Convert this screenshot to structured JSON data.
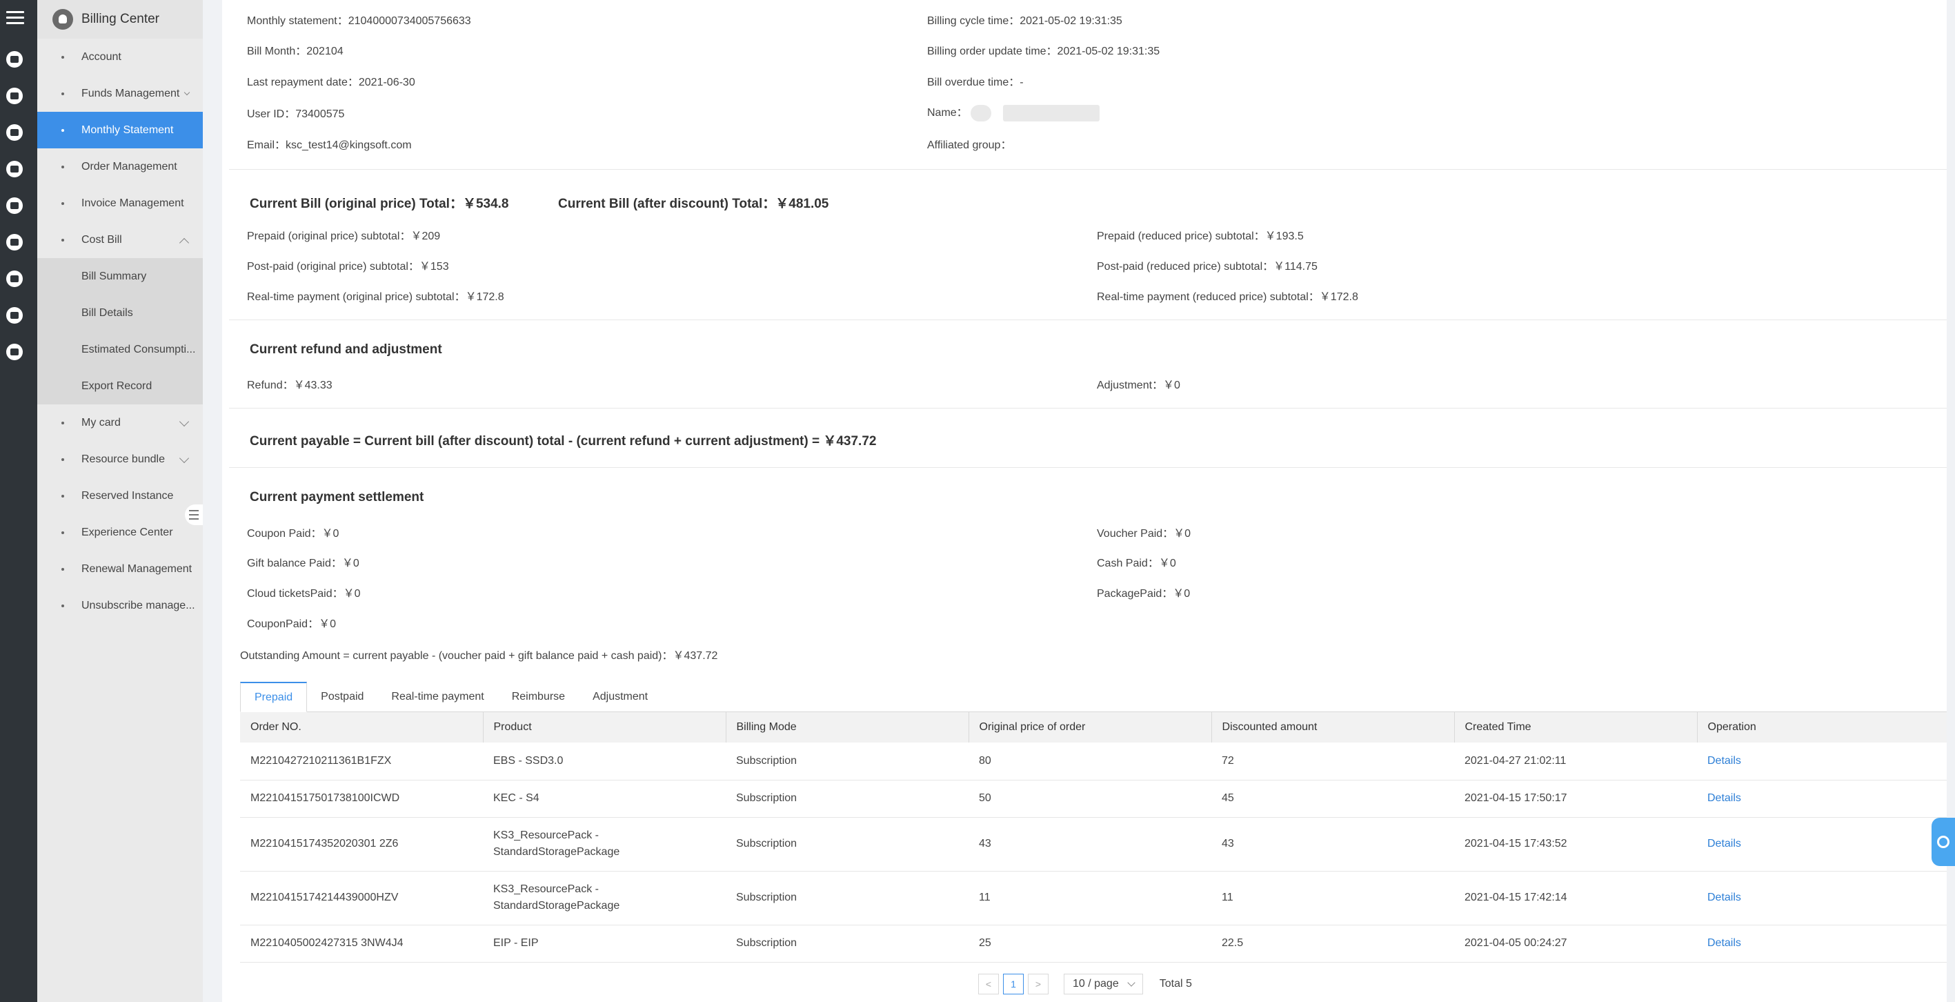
{
  "sidebar": {
    "title": "Billing Center",
    "items": {
      "account": "Account",
      "funds": "Funds Management",
      "monthly": "Monthly Statement",
      "order": "Order Management",
      "invoice": "Invoice Management",
      "cost": "Cost Bill",
      "bill_summary": "Bill Summary",
      "bill_details": "Bill Details",
      "estimated": "Estimated Consumpti...",
      "export": "Export Record",
      "card": "My card",
      "resource": "Resource bundle",
      "reserved": "Reserved Instance",
      "experience": "Experience Center",
      "renewal": "Renewal Management",
      "unsubscribe": "Unsubscribe manage..."
    }
  },
  "info": {
    "statement": "Monthly statement：21040000734005756633",
    "bill_month": "Bill Month：202104",
    "last_repayment": "Last repayment date：2021-06-30",
    "user_id": "User ID：73400575",
    "email": "Email：ksc_test14@kingsoft.com",
    "cycle_time": "Billing cycle time：2021-05-02 19:31:35",
    "order_update": "Billing order update time：2021-05-02 19:31:35",
    "overdue": "Bill overdue time：-",
    "name_label": "Name：",
    "group": "Affiliated group："
  },
  "current_bill": {
    "original_total": "Current Bill (original price) Total：￥534.8",
    "discount_total": "Current Bill (after discount) Total：￥481.05",
    "prepaid_orig": "Prepaid (original price) subtotal：￥209",
    "postpaid_orig": "Post-paid (original price) subtotal：￥153",
    "realtime_orig": "Real-time payment (original price) subtotal：￥172.8",
    "prepaid_red": "Prepaid (reduced price) subtotal：￥193.5",
    "postpaid_red": "Post-paid (reduced price) subtotal：￥114.75",
    "realtime_red": "Real-time payment (reduced price) subtotal：￥172.8"
  },
  "refund": {
    "title": "Current refund and adjustment",
    "refund": "Refund：￥43.33",
    "adjustment": "Adjustment：￥0"
  },
  "payable": {
    "formula": "Current payable = Current bill (after discount) total - (current refund + current adjustment) = ￥437.72"
  },
  "settlement": {
    "title": "Current payment settlement",
    "coupon": "Coupon Paid：￥0",
    "gift": "Gift balance Paid：￥0",
    "cloud": "Cloud ticketsPaid：￥0",
    "couponpaid": "CouponPaid：￥0",
    "voucher": "Voucher Paid：￥0",
    "cash": "Cash Paid：￥0",
    "package": "PackagePaid：￥0",
    "outstanding": "Outstanding Amount = current payable - (voucher paid + gift balance paid + cash paid)：￥437.72"
  },
  "tabs": [
    "Prepaid",
    "Postpaid",
    "Real-time payment",
    "Reimburse",
    "Adjustment"
  ],
  "table": {
    "headers": [
      "Order NO.",
      "Product",
      "Billing Mode",
      "Original price of order",
      "Discounted amount",
      "Created Time",
      "Operation"
    ],
    "rows": [
      [
        "M2210427210211361B1FZX",
        "EBS - SSD3.0",
        "Subscription",
        "80",
        "72",
        "2021-04-27 21:02:11",
        "Details"
      ],
      [
        "M221041517501738100ICWD",
        "KEC - S4",
        "Subscription",
        "50",
        "45",
        "2021-04-15 17:50:17",
        "Details"
      ],
      [
        "M2210415174352020301 2Z6",
        "KS3_ResourcePack - StandardStoragePackage",
        "Subscription",
        "43",
        "43",
        "2021-04-15 17:43:52",
        "Details"
      ],
      [
        "M2210415174214439000HZV",
        "KS3_ResourcePack - StandardStoragePackage",
        "Subscription",
        "11",
        "11",
        "2021-04-15 17:42:14",
        "Details"
      ],
      [
        "M2210405002427315 3NW4J4",
        "EIP - EIP",
        "Subscription",
        "25",
        "22.5",
        "2021-04-05 00:24:27",
        "Details"
      ]
    ]
  },
  "pagination": {
    "prev": "<",
    "current": "1",
    "next": ">",
    "per_page": "10 / page",
    "total": "Total 5"
  }
}
